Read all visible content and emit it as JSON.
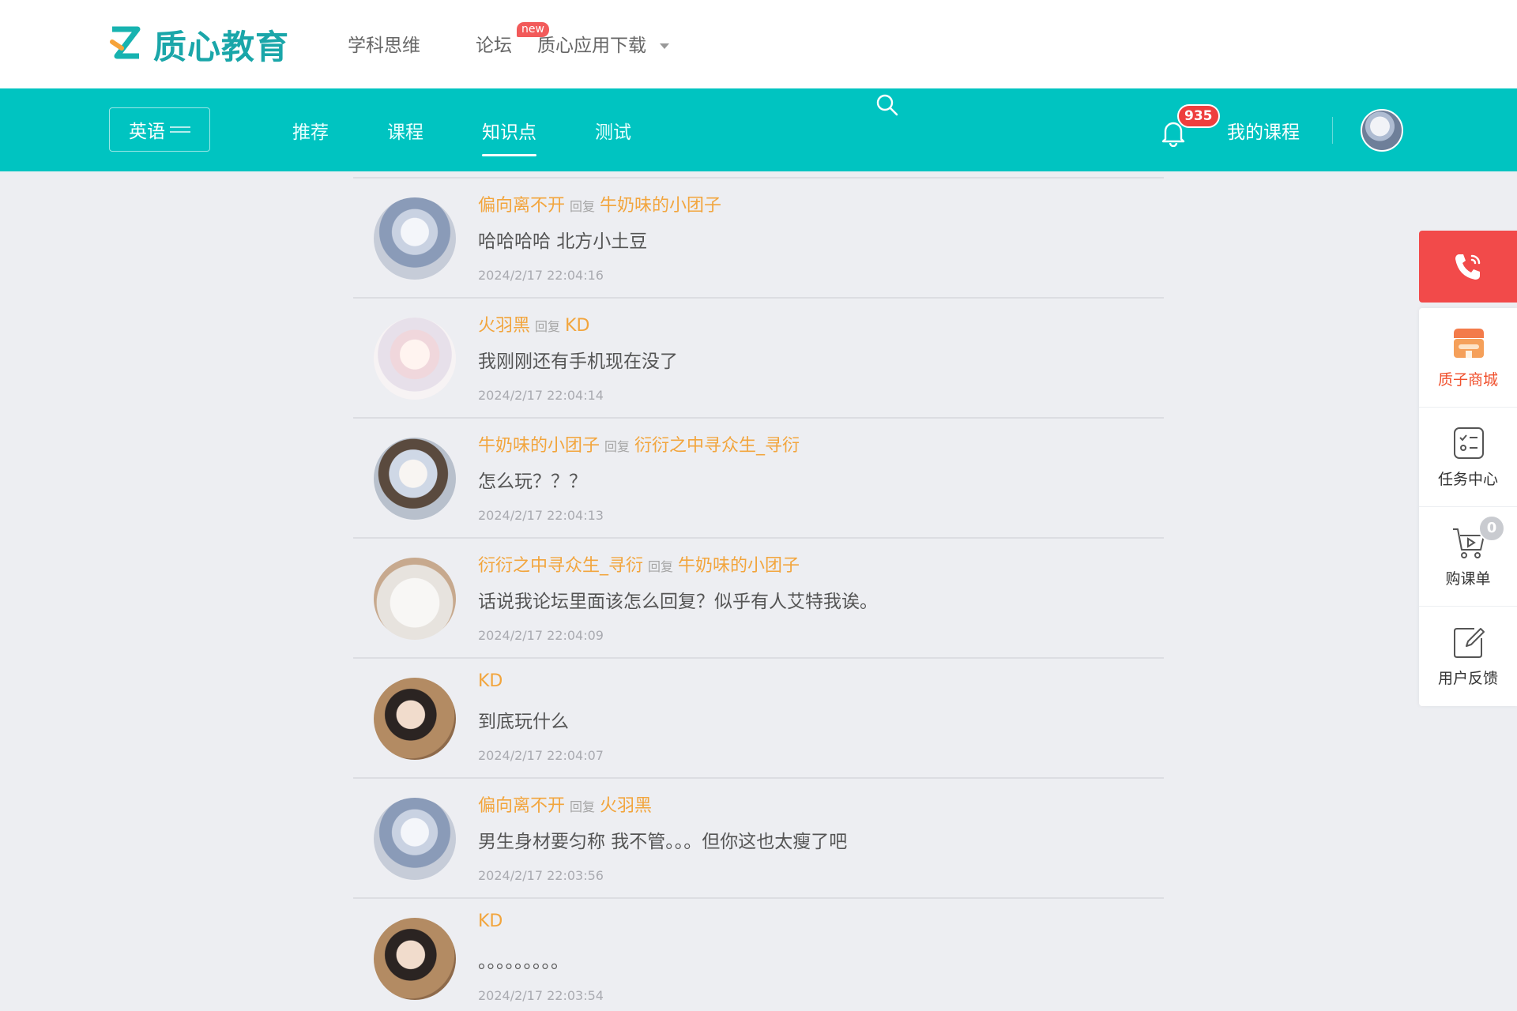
{
  "header": {
    "logo_text": "质心教育",
    "nav": [
      {
        "label": "学科思维"
      },
      {
        "label": "论坛",
        "badge": "new"
      },
      {
        "label": "质心应用下载"
      }
    ]
  },
  "navbar": {
    "subject": "英语",
    "tabs": [
      {
        "label": "推荐",
        "active": false
      },
      {
        "label": "课程",
        "active": false
      },
      {
        "label": "知识点",
        "active": true
      },
      {
        "label": "测试",
        "active": false
      }
    ],
    "notification_count": "935",
    "my_courses": "我的课程"
  },
  "comments": [
    {
      "author": "偏向离不开",
      "reply_word": "回复",
      "reply_to": "牛奶味的小团子",
      "text": "哈哈哈哈 北方小土豆",
      "time": "2024/2/17 22:04:16",
      "avatar": "av-blue"
    },
    {
      "author": "火羽黑",
      "reply_word": "回复",
      "reply_to": "KD",
      "text": "我刚刚还有手机现在没了",
      "time": "2024/2/17 22:04:14",
      "avatar": "av-pink"
    },
    {
      "author": "牛奶味的小团子",
      "reply_word": "回复",
      "reply_to": "衍衍之中寻众生_寻衍",
      "text": "怎么玩？？？",
      "time": "2024/2/17 22:04:13",
      "avatar": "av-blue2"
    },
    {
      "author": "衍衍之中寻众生_寻衍",
      "reply_word": "回复",
      "reply_to": "牛奶味的小团子",
      "text": "话说我论坛里面该怎么回复？似乎有人艾特我诶。",
      "time": "2024/2/17 22:04:09",
      "avatar": "av-cat"
    },
    {
      "author": "KD",
      "reply_word": "",
      "reply_to": "",
      "text": "到底玩什么",
      "time": "2024/2/17 22:04:07",
      "avatar": "av-girl"
    },
    {
      "author": "偏向离不开",
      "reply_word": "回复",
      "reply_to": "火羽黑",
      "text": "男生身材要匀称 我不管。。。但你这也太瘦了吧",
      "time": "2024/2/17 22:03:56",
      "avatar": "av-blue"
    },
    {
      "author": "KD",
      "reply_word": "",
      "reply_to": "",
      "text": "。。。。。。。。。",
      "time": "2024/2/17 22:03:54",
      "avatar": "av-girl"
    }
  ],
  "side_panel": {
    "items": [
      {
        "label": "质子商城",
        "icon": "shop-icon"
      },
      {
        "label": "任务中心",
        "icon": "task-icon"
      },
      {
        "label": "购课单",
        "icon": "cart-icon",
        "badge": "0"
      },
      {
        "label": "用户反馈",
        "icon": "feedback-icon"
      }
    ]
  },
  "colors": {
    "brand": "#00c4c1",
    "username": "#f2a53d",
    "call": "#f24a4a",
    "badge": "#ee3e3e"
  }
}
